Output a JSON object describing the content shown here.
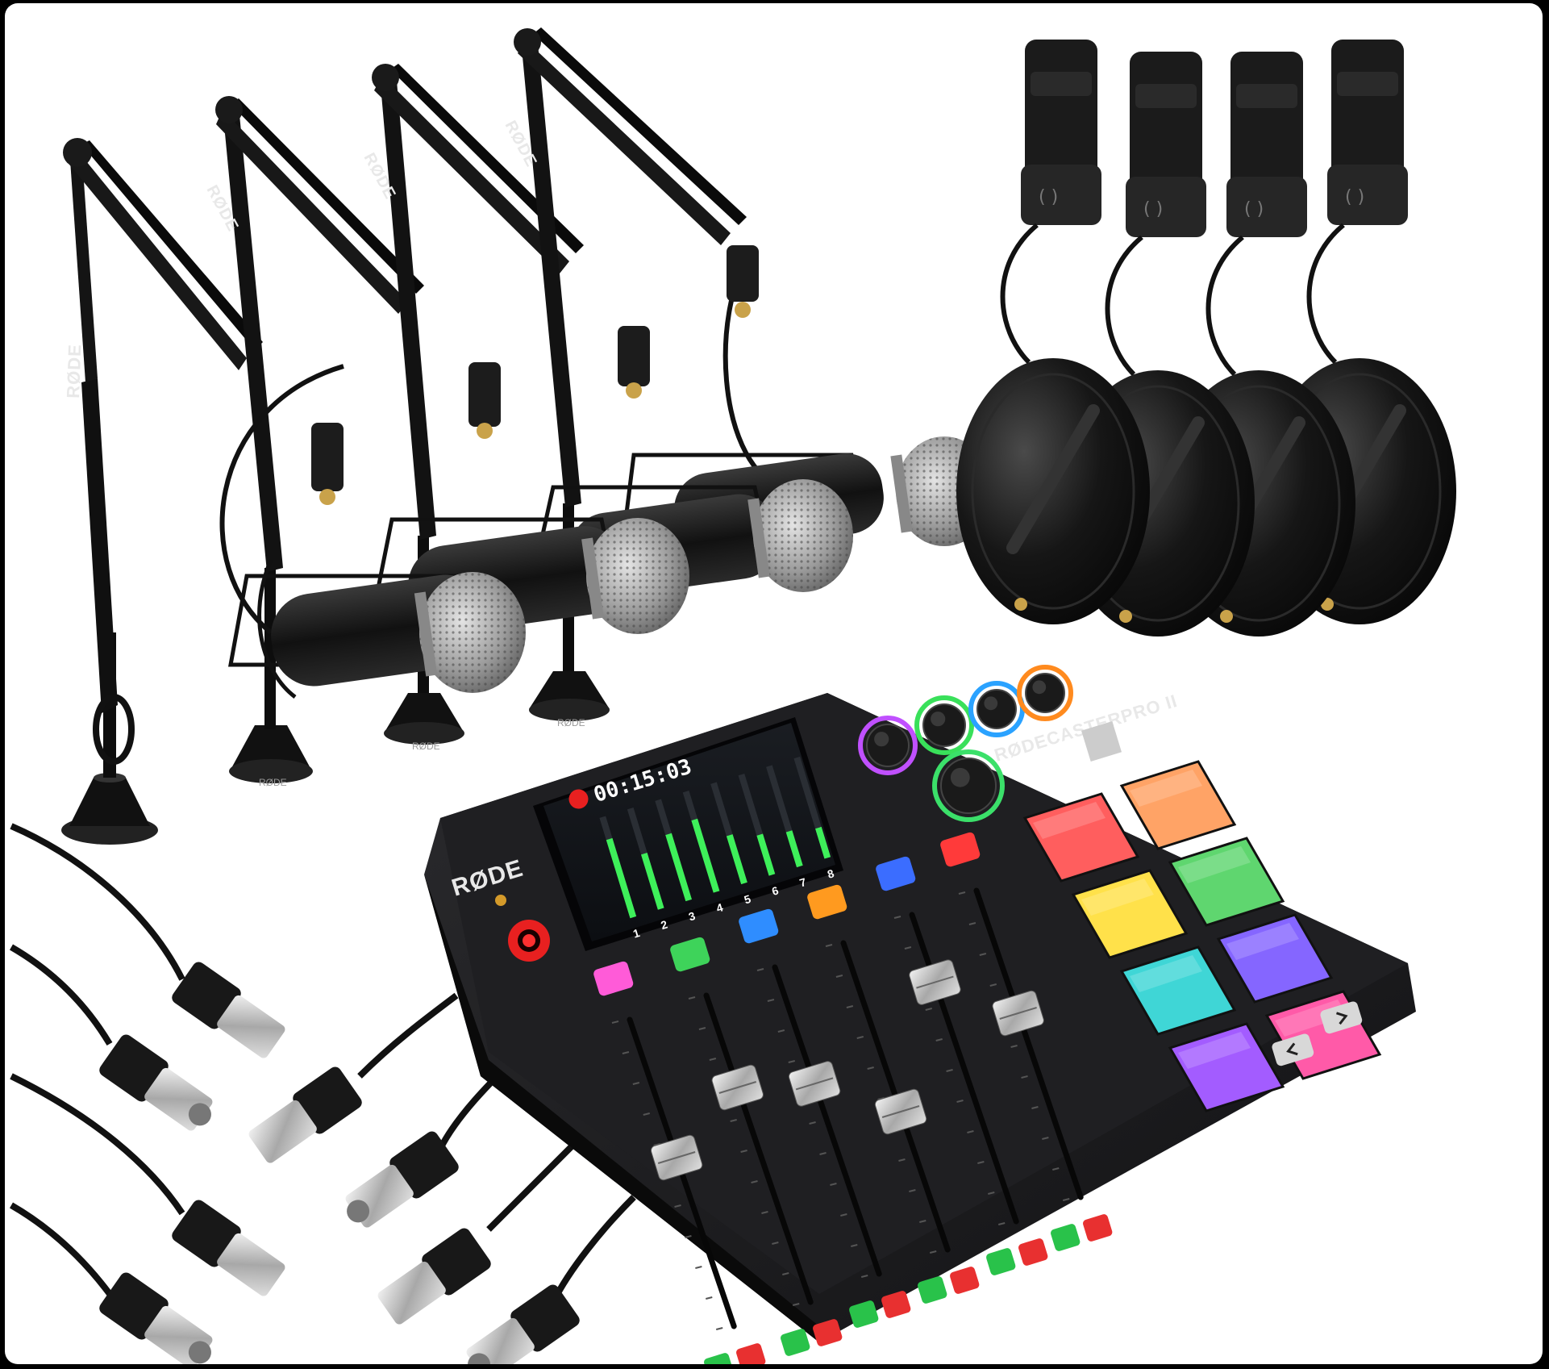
{
  "scene": {
    "description_items": [
      "boom-arm",
      "microphone",
      "headphones",
      "mixer",
      "xlr-cable"
    ],
    "counts": {
      "boom_arms": 4,
      "microphones": 4,
      "headphones": 4,
      "xlr_cables": 4
    }
  },
  "branding": {
    "mixer_logo": "RØDE",
    "mixer_model": "RØDECASTERPRO II",
    "arm_logo": "RØDE",
    "base_logo": "RØDE"
  },
  "screen": {
    "timer": "00:15:03",
    "channels": [
      "1",
      "2",
      "3",
      "4",
      "5",
      "6",
      "7",
      "8"
    ],
    "level_values": [
      0.78,
      0.55,
      0.66,
      0.72,
      0.48,
      0.4,
      0.35,
      0.3
    ]
  },
  "mixer": {
    "channel_button_colors": [
      "#ff5bd8",
      "#3ed35a",
      "#2f8dff",
      "#ff9a1f",
      "#3b6dff",
      "#ff3a3a"
    ],
    "knob_ring_colors": [
      "#c050ff",
      "#39e05a",
      "#2aa2ff",
      "#ff8a1e",
      "#3be06a"
    ],
    "pad_colors": [
      "#ff5e5e",
      "#ffa366",
      "#5fd66f",
      "#ffe14a",
      "#8566ff",
      "#3fd6d6",
      "#a35cff",
      "#ff5aa8"
    ],
    "fader_levels": [
      0.55,
      0.7,
      0.62,
      0.45,
      0.78,
      0.6
    ]
  },
  "colors": {
    "background": "#ffffff",
    "device_body": "#1c1c1e",
    "accent_red": "#e82020",
    "screen_green": "#3ef05a"
  }
}
